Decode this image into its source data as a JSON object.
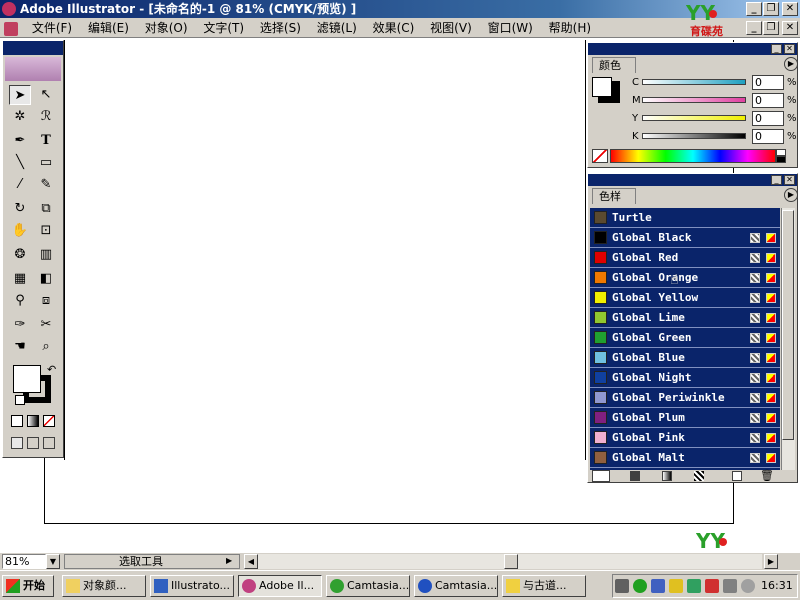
{
  "window": {
    "title": "Adobe Illustrator - [未命名的-1 @ 81% (CMYK/预览) ]",
    "minimize_glyph": "_",
    "restore_glyph": "❐",
    "close_glyph": "✕"
  },
  "menubar": {
    "items": [
      "文件(F)",
      "编辑(E)",
      "对象(O)",
      "文字(T)",
      "选择(S)",
      "滤镜(L)",
      "效果(C)",
      "视图(V)",
      "窗口(W)",
      "帮助(H)"
    ]
  },
  "watermark": {
    "text": "育碟苑"
  },
  "color_panel": {
    "tab": "颜色",
    "channels": [
      {
        "label": "C",
        "value": "0",
        "unit": "%",
        "color": "#20a0c0"
      },
      {
        "label": "M",
        "value": "0",
        "unit": "%",
        "color": "#e040a0"
      },
      {
        "label": "Y",
        "value": "0",
        "unit": "%",
        "color": "#f0f000"
      },
      {
        "label": "K",
        "value": "0",
        "unit": "%",
        "color": "#000000"
      }
    ]
  },
  "swatches_panel": {
    "tab": "色样",
    "items": [
      {
        "name": "Turtle",
        "color": "#5a4a30"
      },
      {
        "name": "Global Black",
        "color": "#000000"
      },
      {
        "name": "Global Red",
        "color": "#e00000"
      },
      {
        "name": "Global Orange",
        "color": "#f07800"
      },
      {
        "name": "Global Yellow",
        "color": "#f0f000"
      },
      {
        "name": "Global Lime",
        "color": "#90c830"
      },
      {
        "name": "Global Green",
        "color": "#20a030"
      },
      {
        "name": "Global Blue",
        "color": "#70c0e0"
      },
      {
        "name": "Global Night",
        "color": "#1040a0"
      },
      {
        "name": "Global Periwinkle",
        "color": "#9098d0"
      },
      {
        "name": "Global Plum",
        "color": "#802080"
      },
      {
        "name": "Global Pink",
        "color": "#f0b0d0"
      },
      {
        "name": "Global Malt",
        "color": "#906040"
      }
    ]
  },
  "statusbar": {
    "zoom": "81%",
    "tool": "选取工具"
  },
  "taskbar": {
    "start": "开始",
    "buttons": [
      {
        "label": "对象颜...",
        "active": false
      },
      {
        "label": "Illustrato...",
        "active": false
      },
      {
        "label": "Adobe Il...",
        "active": true
      },
      {
        "label": "Camtasia...",
        "active": false
      },
      {
        "label": "Camtasia...",
        "active": false
      },
      {
        "label": "与古道...",
        "active": false
      }
    ],
    "clock": "16:31"
  }
}
